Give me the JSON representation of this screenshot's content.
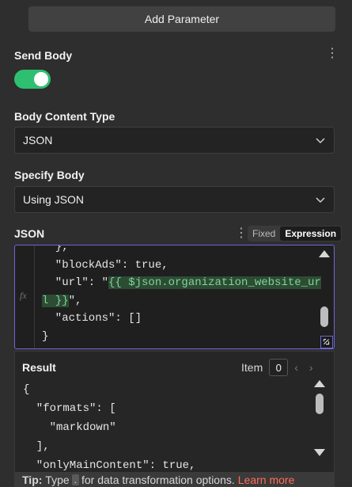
{
  "add_parameter": {
    "label": "Add Parameter"
  },
  "send_body": {
    "label": "Send Body",
    "enabled": true,
    "accent": "#2fbf71"
  },
  "body_content_type": {
    "label": "Body Content Type",
    "value": "JSON"
  },
  "specify_body": {
    "label": "Specify Body",
    "value": "Using JSON"
  },
  "json_field": {
    "label": "JSON",
    "mode_options": [
      "Fixed",
      "Expression"
    ],
    "active_mode": "Expression",
    "fx_label": "fx",
    "lines": [
      "  },",
      "  \"blockAds\": true,",
      "  \"url\": \"",
      "l }}\",",
      "  \"actions\": []",
      "}"
    ],
    "expression_part1": "{{ $json.organization_website_ur",
    "expression_part2": "l }}",
    "url_suffix": "\","
  },
  "result": {
    "label": "Result",
    "item_label": "Item",
    "item_index": "0",
    "lines": [
      "{",
      "  \"formats\": [",
      "    \"markdown\"",
      "  ],",
      "  \"onlyMainContent\": true,"
    ]
  },
  "tip": {
    "prefix": "Tip:",
    "text_before": "Type",
    "key": ".",
    "text_after": "for data transformation options.",
    "link": "Learn more"
  },
  "colors": {
    "background": "#2e2e2e",
    "editor_border": "#6e67d6",
    "link": "#ff6d5a",
    "expression_highlight": "#7fd59a"
  }
}
